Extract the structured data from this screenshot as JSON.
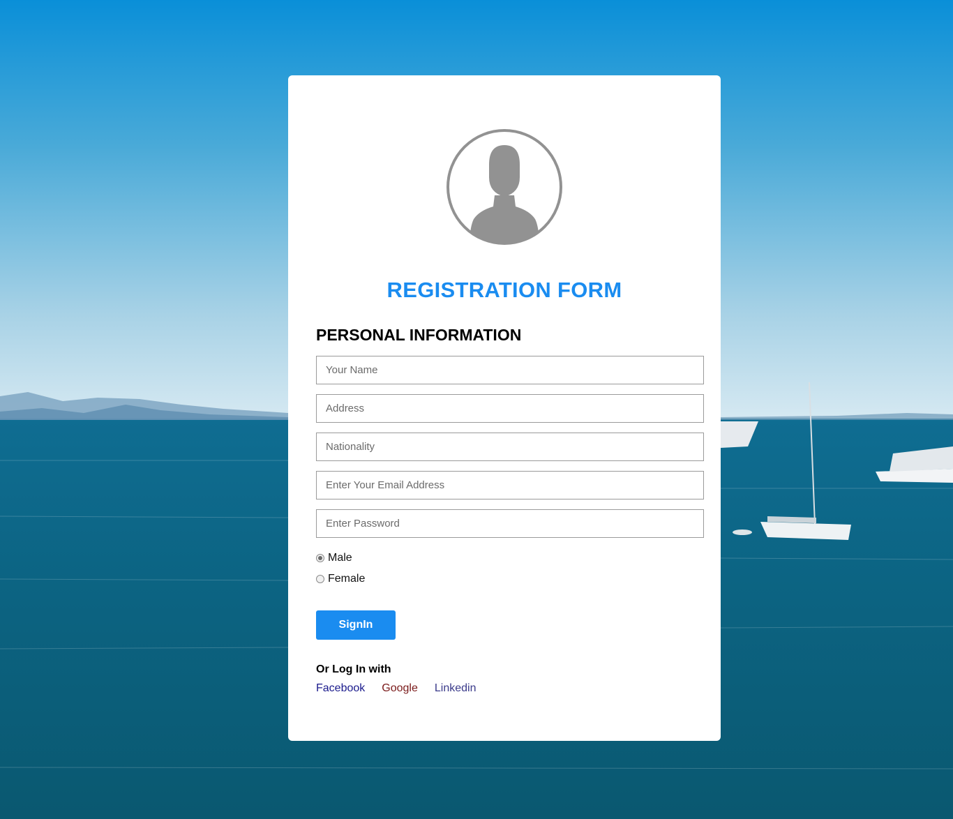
{
  "background": {
    "description_colors": {
      "sky_top": "#0a8fd8",
      "sky_horizon": "#d6e9f2",
      "sea": "#0b5f7d"
    }
  },
  "form": {
    "title": "REGISTRATION FORM",
    "section_title": "PERSONAL INFORMATION",
    "fields": {
      "name": {
        "placeholder": "Your Name",
        "value": ""
      },
      "address": {
        "placeholder": "Address",
        "value": ""
      },
      "nationality": {
        "placeholder": "Nationality",
        "value": ""
      },
      "email": {
        "placeholder": "Enter Your Email Address",
        "value": ""
      },
      "password": {
        "placeholder": "Enter Password",
        "value": ""
      }
    },
    "gender": {
      "options": [
        "Male",
        "Female"
      ],
      "selected": "Male"
    },
    "submit_label": "SignIn",
    "alt_login_label": "Or Log In with",
    "social": {
      "facebook": {
        "label": "Facebook",
        "color": "#1a1a8c"
      },
      "google": {
        "label": "Google",
        "color": "#7a1a1a"
      },
      "linkedin": {
        "label": "Linkedin",
        "color": "#3a3a8a"
      }
    },
    "accent_color": "#1a8cf0",
    "avatar_icon": "user-avatar-icon"
  }
}
